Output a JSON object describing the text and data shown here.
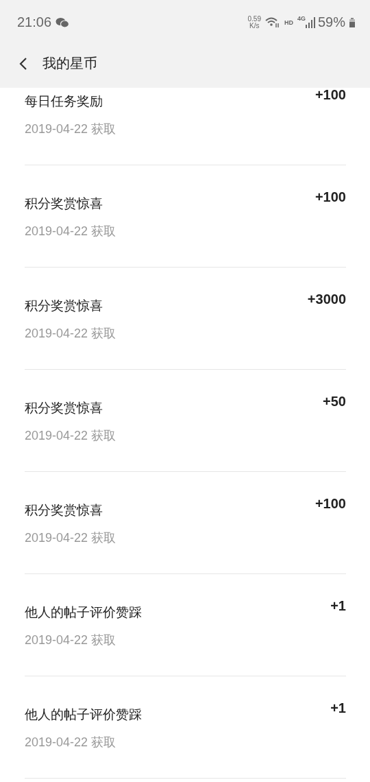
{
  "status_bar": {
    "time": "21:06",
    "speed_value": "0.59",
    "speed_unit": "K/s",
    "hd": "HD",
    "network": "4G",
    "battery": "59%"
  },
  "header": {
    "title": "我的星币"
  },
  "records": [
    {
      "title": "每日任务奖励",
      "date": "2019-04-22 获取",
      "points": "+100"
    },
    {
      "title": "积分奖赏惊喜",
      "date": "2019-04-22 获取",
      "points": "+100"
    },
    {
      "title": "积分奖赏惊喜",
      "date": "2019-04-22 获取",
      "points": "+3000"
    },
    {
      "title": "积分奖赏惊喜",
      "date": "2019-04-22 获取",
      "points": "+50"
    },
    {
      "title": "积分奖赏惊喜",
      "date": "2019-04-22 获取",
      "points": "+100"
    },
    {
      "title": "他人的帖子评价赞踩",
      "date": "2019-04-22 获取",
      "points": "+1"
    },
    {
      "title": "他人的帖子评价赞踩",
      "date": "2019-04-22 获取",
      "points": "+1"
    }
  ]
}
